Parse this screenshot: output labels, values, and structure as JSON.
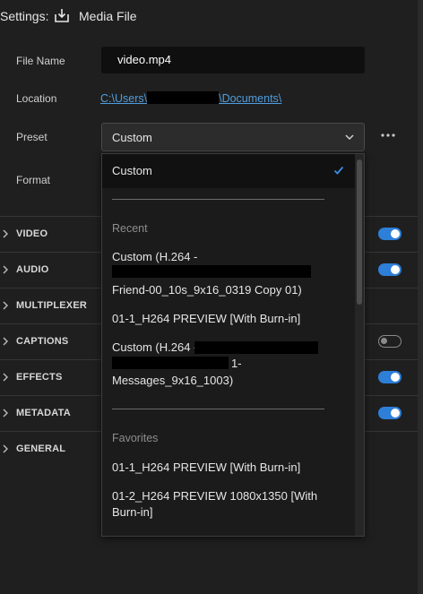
{
  "header": {
    "title": "Settings:",
    "media_file": "Media File"
  },
  "fields": {
    "file_name_label": "File Name",
    "file_name_value": "video.mp4",
    "location_label": "Location",
    "location_prefix": "C:\\Users\\",
    "location_suffix": "\\Documents\\",
    "preset_label": "Preset",
    "preset_value": "Custom",
    "format_label": "Format"
  },
  "sections": [
    {
      "name": "VIDEO",
      "toggle": "on"
    },
    {
      "name": "AUDIO",
      "toggle": "on"
    },
    {
      "name": "MULTIPLEXER",
      "toggle": "none"
    },
    {
      "name": "CAPTIONS",
      "toggle": "off"
    },
    {
      "name": "EFFECTS",
      "toggle": "on"
    },
    {
      "name": "METADATA",
      "toggle": "on"
    },
    {
      "name": "GENERAL",
      "toggle": "none"
    }
  ],
  "dropdown": {
    "selected": "Custom",
    "recent_heading": "Recent",
    "recent": [
      {
        "line1": "Custom (H.264 -",
        "line3": "Friend-00_10s_9x16_0319 Copy 01)"
      },
      {
        "line1": "01-1_H264 PREVIEW [With Burn-in]"
      },
      {
        "line1": "Custom (H.264 -",
        "line2_tail": "1-",
        "line3": "Messages_9x16_1003)"
      }
    ],
    "favorites_heading": "Favorites",
    "favorites": [
      {
        "line1": "01-1_H264 PREVIEW [With Burn-in]"
      },
      {
        "line1": "01-2_H264 PREVIEW 1080x1350 [With",
        "line2": "Burn-in]"
      }
    ]
  },
  "colors": {
    "accent": "#2d7fd8",
    "link": "#4f9dde",
    "background": "#1f1f1f"
  },
  "icons": {
    "export": "export-icon",
    "chevron": "chevron-down-icon",
    "more": "more-icon",
    "check": "checkmark-icon"
  }
}
